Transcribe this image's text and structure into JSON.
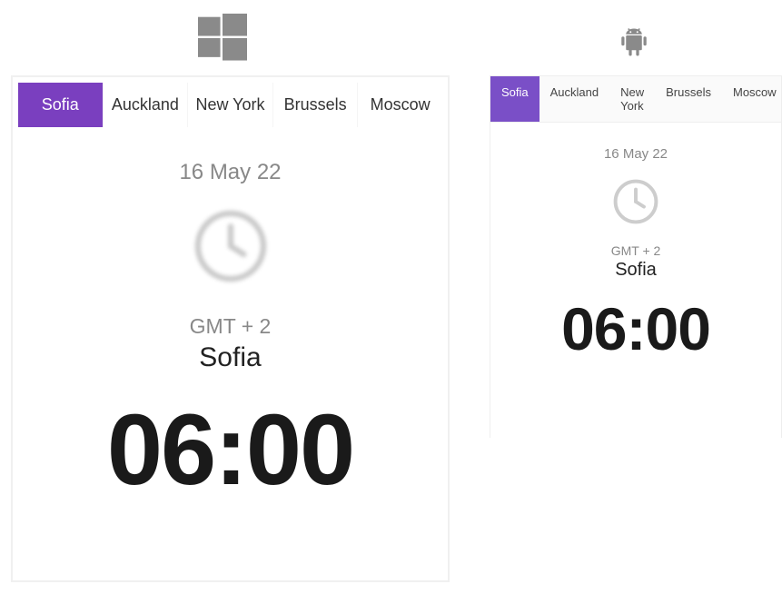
{
  "platforms": {
    "windows": {
      "tabs": [
        {
          "label": "Sofia",
          "active": true
        },
        {
          "label": "Auckland",
          "active": false
        },
        {
          "label": "New York",
          "active": false
        },
        {
          "label": "Brussels",
          "active": false
        },
        {
          "label": "Moscow",
          "active": false
        }
      ],
      "date": "16 May 22",
      "gmt": "GMT + 2",
      "city": "Sofia",
      "time": "06:00"
    },
    "android": {
      "tabs": [
        {
          "label": "Sofia",
          "active": true
        },
        {
          "label": "Auckland",
          "active": false
        },
        {
          "label": "New York",
          "active": false
        },
        {
          "label": "Brussels",
          "active": false
        },
        {
          "label": "Moscow",
          "active": false
        }
      ],
      "date": "16 May 22",
      "gmt": "GMT + 2",
      "city": "Sofia",
      "time": "06:00"
    }
  },
  "colors": {
    "accent": "#7a3fbf",
    "muted": "#888888",
    "text": "#222222"
  }
}
